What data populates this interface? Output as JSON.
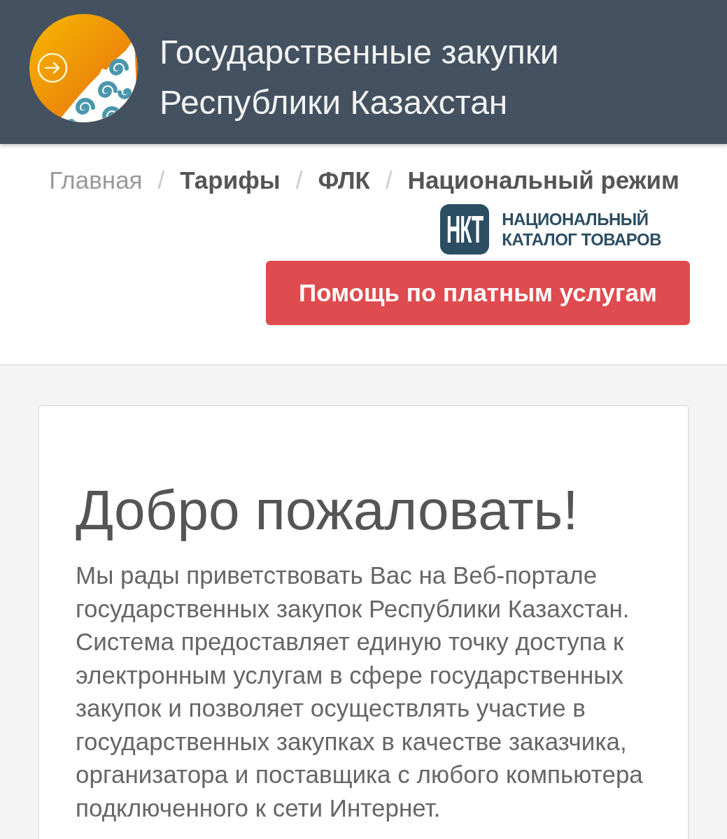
{
  "header": {
    "title": "Государственные закупки Республики Казахстан"
  },
  "breadcrumbs": [
    {
      "label": "Главная",
      "selected": true
    },
    {
      "label": "Тарифы",
      "selected": false,
      "separator": "/"
    },
    {
      "label": "ФЛК",
      "selected": false,
      "separator": "/"
    },
    {
      "label": "Национальный режим",
      "selected": false,
      "separator": "/"
    }
  ],
  "catalog_logo": {
    "mark": "НКТ",
    "lines": [
      "НАЦИОНАЛЬНЫЙ",
      "КАТАЛОГ ТОВАРОВ"
    ]
  },
  "help_button": {
    "label": "Помощь по платным услугам"
  },
  "welcome": {
    "heading": "Добро пожаловать!",
    "text": "Мы рады приветствовать Вас на Веб-портале государственных закупок Республики Казахстан. Система предоставляет единую точку доступа к электронным услугам в сфере государственных закупок и позволяет осуществлять участие в государственных закупках в качестве заказчика, организатора и поставщика с любого компьютера подключенного к сети Интернет."
  }
}
